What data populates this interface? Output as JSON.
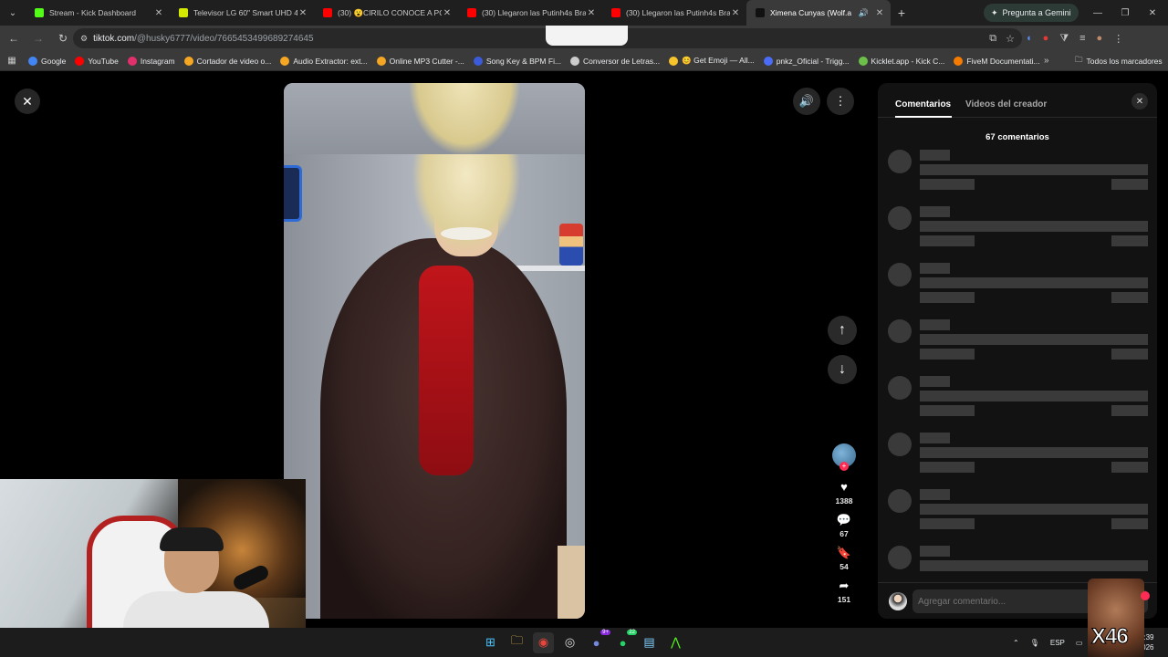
{
  "browser": {
    "tabs": [
      {
        "title": "Stream - Kick Dashboard",
        "color": "#53fc18",
        "active": false
      },
      {
        "title": "Televisor LG 60\" Smart UHD 4K",
        "color": "#d4e800",
        "active": false
      },
      {
        "title": "(30) 😮CIRILO CONOCE A POM",
        "color": "#ff0000",
        "active": false
      },
      {
        "title": "(30) Llegaron las Putinh4s Brasi",
        "color": "#ff0000",
        "active": false
      },
      {
        "title": "(30) Llegaron las Putinh4s Brasi",
        "color": "#ff0000",
        "active": false
      },
      {
        "title": "Ximena Cunyas (Wolf.a",
        "color": "#111111",
        "active": true
      }
    ],
    "gemini_label": "Pregunta a Gemini",
    "url_host": "tiktok.com",
    "url_path": "/@husky6777/video/7665453499689274645",
    "bookmarks": [
      {
        "label": "Google",
        "color": "#4285f4"
      },
      {
        "label": "YouTube",
        "color": "#ff0000"
      },
      {
        "label": "Instagram",
        "color": "#e1306c"
      },
      {
        "label": "Cortador de video o...",
        "color": "#f5a623"
      },
      {
        "label": "Audio Extractor: ext...",
        "color": "#f5a623"
      },
      {
        "label": "Online MP3 Cutter -...",
        "color": "#f5a623"
      },
      {
        "label": "Song Key & BPM Fi...",
        "color": "#3b5bdb"
      },
      {
        "label": "Conversor de Letras...",
        "color": "#cccccc"
      },
      {
        "label": "😊 Get Emoji — All...",
        "color": "#f7c52b"
      },
      {
        "label": "pnkz_Oficial - Trigg...",
        "color": "#4a6cf7"
      },
      {
        "label": "Kicklet.app - Kick C...",
        "color": "#6cc04a"
      },
      {
        "label": "FiveM Documentati...",
        "color": "#f57c00"
      }
    ],
    "all_bookmarks_label": "Todos los marcadores"
  },
  "player": {
    "actions": {
      "likes": "1388",
      "comments": "67",
      "saves": "54",
      "shares": "151"
    }
  },
  "comments_panel": {
    "tab_comments": "Comentarios",
    "tab_creator_videos": "Videos del creador",
    "count_label": "67 comentarios",
    "input_placeholder": "Agregar comentario..."
  },
  "taskbar": {
    "language": "ESP",
    "time": "1:39",
    "date": "5/2026",
    "badge_discord": "9+",
    "badge_whatsapp": "22"
  },
  "overlay": {
    "meme_text": "X46"
  }
}
